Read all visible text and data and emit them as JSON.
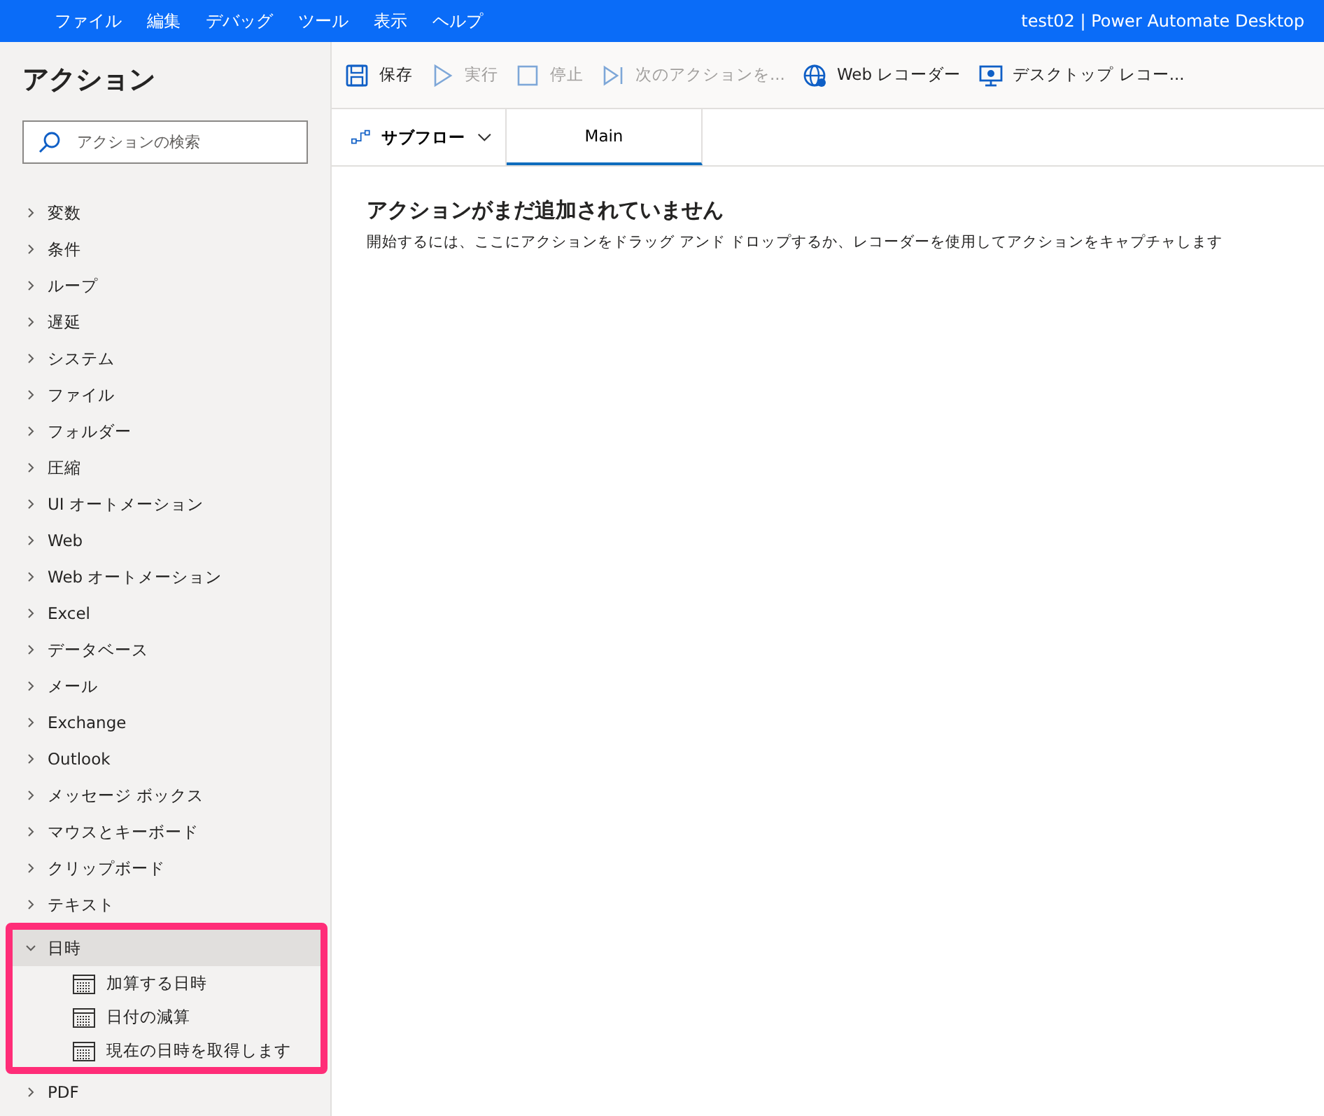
{
  "menu_bar": {
    "items": [
      "ファイル",
      "編集",
      "デバッグ",
      "ツール",
      "表示",
      "ヘルプ"
    ],
    "window_title": "test02 | Power Automate Desktop"
  },
  "sidebar": {
    "title": "アクション",
    "search": {
      "placeholder": "アクションの検索"
    },
    "categories": [
      {
        "label": "変数",
        "expanded": false
      },
      {
        "label": "条件",
        "expanded": false
      },
      {
        "label": "ループ",
        "expanded": false
      },
      {
        "label": "遅延",
        "expanded": false
      },
      {
        "label": "システム",
        "expanded": false
      },
      {
        "label": "ファイル",
        "expanded": false
      },
      {
        "label": "フォルダー",
        "expanded": false
      },
      {
        "label": "圧縮",
        "expanded": false
      },
      {
        "label": "UI オートメーション",
        "expanded": false
      },
      {
        "label": "Web",
        "expanded": false
      },
      {
        "label": "Web オートメーション",
        "expanded": false
      },
      {
        "label": "Excel",
        "expanded": false
      },
      {
        "label": "データベース",
        "expanded": false
      },
      {
        "label": "メール",
        "expanded": false
      },
      {
        "label": "Exchange",
        "expanded": false
      },
      {
        "label": "Outlook",
        "expanded": false
      },
      {
        "label": "メッセージ ボックス",
        "expanded": false
      },
      {
        "label": "マウスとキーボード",
        "expanded": false
      },
      {
        "label": "クリップボード",
        "expanded": false
      },
      {
        "label": "テキスト",
        "expanded": false
      },
      {
        "label": "日時",
        "expanded": true,
        "highlighted": true,
        "children": [
          {
            "label": "加算する日時"
          },
          {
            "label": "日付の減算"
          },
          {
            "label": "現在の日時を取得します"
          }
        ]
      },
      {
        "label": "PDF",
        "expanded": false
      }
    ]
  },
  "toolbar": [
    {
      "kind": "save",
      "label": "保存",
      "disabled": false
    },
    {
      "kind": "run",
      "label": "実行",
      "disabled": true
    },
    {
      "kind": "stop",
      "label": "停止",
      "disabled": true
    },
    {
      "kind": "next",
      "label": "次のアクションを...",
      "disabled": true
    },
    {
      "kind": "web",
      "label": "Web レコーダー",
      "disabled": false
    },
    {
      "kind": "desktop",
      "label": "デスクトップ レコー...",
      "disabled": false
    }
  ],
  "subflow_button": {
    "label": "サブフロー"
  },
  "tabs": [
    {
      "label": "Main",
      "selected": true
    }
  ],
  "empty_state": {
    "heading": "アクションがまだ追加されていません",
    "message": "開始するには、ここにアクションをドラッグ アンド ドロップするか、レコーダーを使用してアクションをキャプチャします"
  }
}
